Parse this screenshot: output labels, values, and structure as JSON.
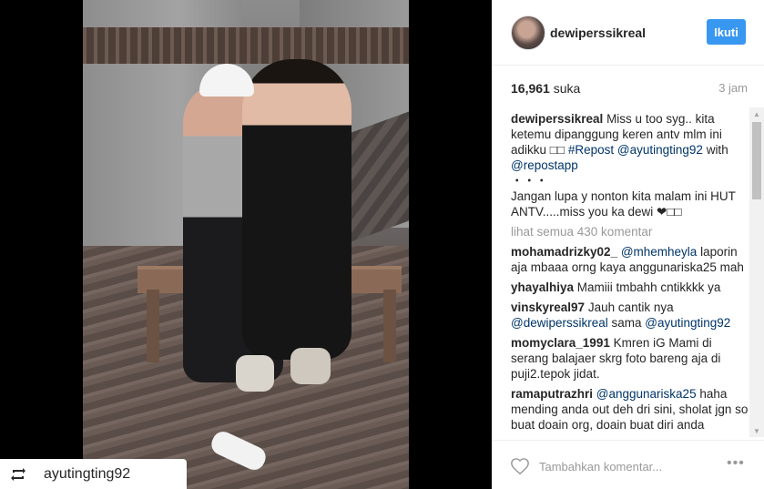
{
  "post": {
    "username": "dewiperssikreal",
    "follow_label": "Ikuti",
    "likes_count": "16,961",
    "likes_label": "suka",
    "time_ago": "3 jam",
    "repost_username": "ayutingting92"
  },
  "caption": {
    "user": "dewiperssikreal",
    "text1": " Miss u too syg.. kita ketemu dipanggung keren antv mlm ini adikku □□ ",
    "tag1": "#Repost",
    "text2": " ",
    "tag2": "@ayutingting92",
    "text3": " with ",
    "tag3": "@repostapp",
    "dots": "・・・",
    "text4": "Jangan lupa y nonton kita malam ini HUT ANTV.....miss you ka dewi ❤□□"
  },
  "view_all_comments": "lihat semua 430 komentar",
  "comments": [
    {
      "user": "mohamadrizky02_",
      "parts": [
        {
          "t": " "
        },
        {
          "tag": "@mhemheyla"
        },
        {
          "t": " laporin aja mbaaa orng kaya anggunariska25 mah"
        }
      ]
    },
    {
      "user": "yhayalhiya",
      "parts": [
        {
          "t": " Mamiii tmbahh cntikkkk ya"
        }
      ]
    },
    {
      "user": "vinskyreal97",
      "parts": [
        {
          "t": " Jauh cantik nya "
        },
        {
          "tag": "@dewiperssikreal"
        },
        {
          "t": " sama "
        },
        {
          "tag": "@ayutingting92"
        }
      ]
    },
    {
      "user": "momyclara_1991",
      "parts": [
        {
          "t": " Kmren iG Mami di serang balajaer skrg foto bareng aja di puji2.tepok jidat."
        }
      ]
    },
    {
      "user": "ramaputrazhri",
      "parts": [
        {
          "t": " "
        },
        {
          "tag": "@anggunariska25"
        },
        {
          "t": " haha mending anda out deh dri sini, sholat jgn so buat doain org, doain buat diri anda"
        }
      ]
    }
  ],
  "footer": {
    "comment_placeholder": "Tambahkan komentar...",
    "more_label": "•••"
  },
  "colors": {
    "follow_button": "#3897f0",
    "link": "#003569",
    "muted": "#999999"
  },
  "icons": {
    "repost": "repost-icon",
    "like": "heart-icon",
    "more": "more-options-icon"
  }
}
